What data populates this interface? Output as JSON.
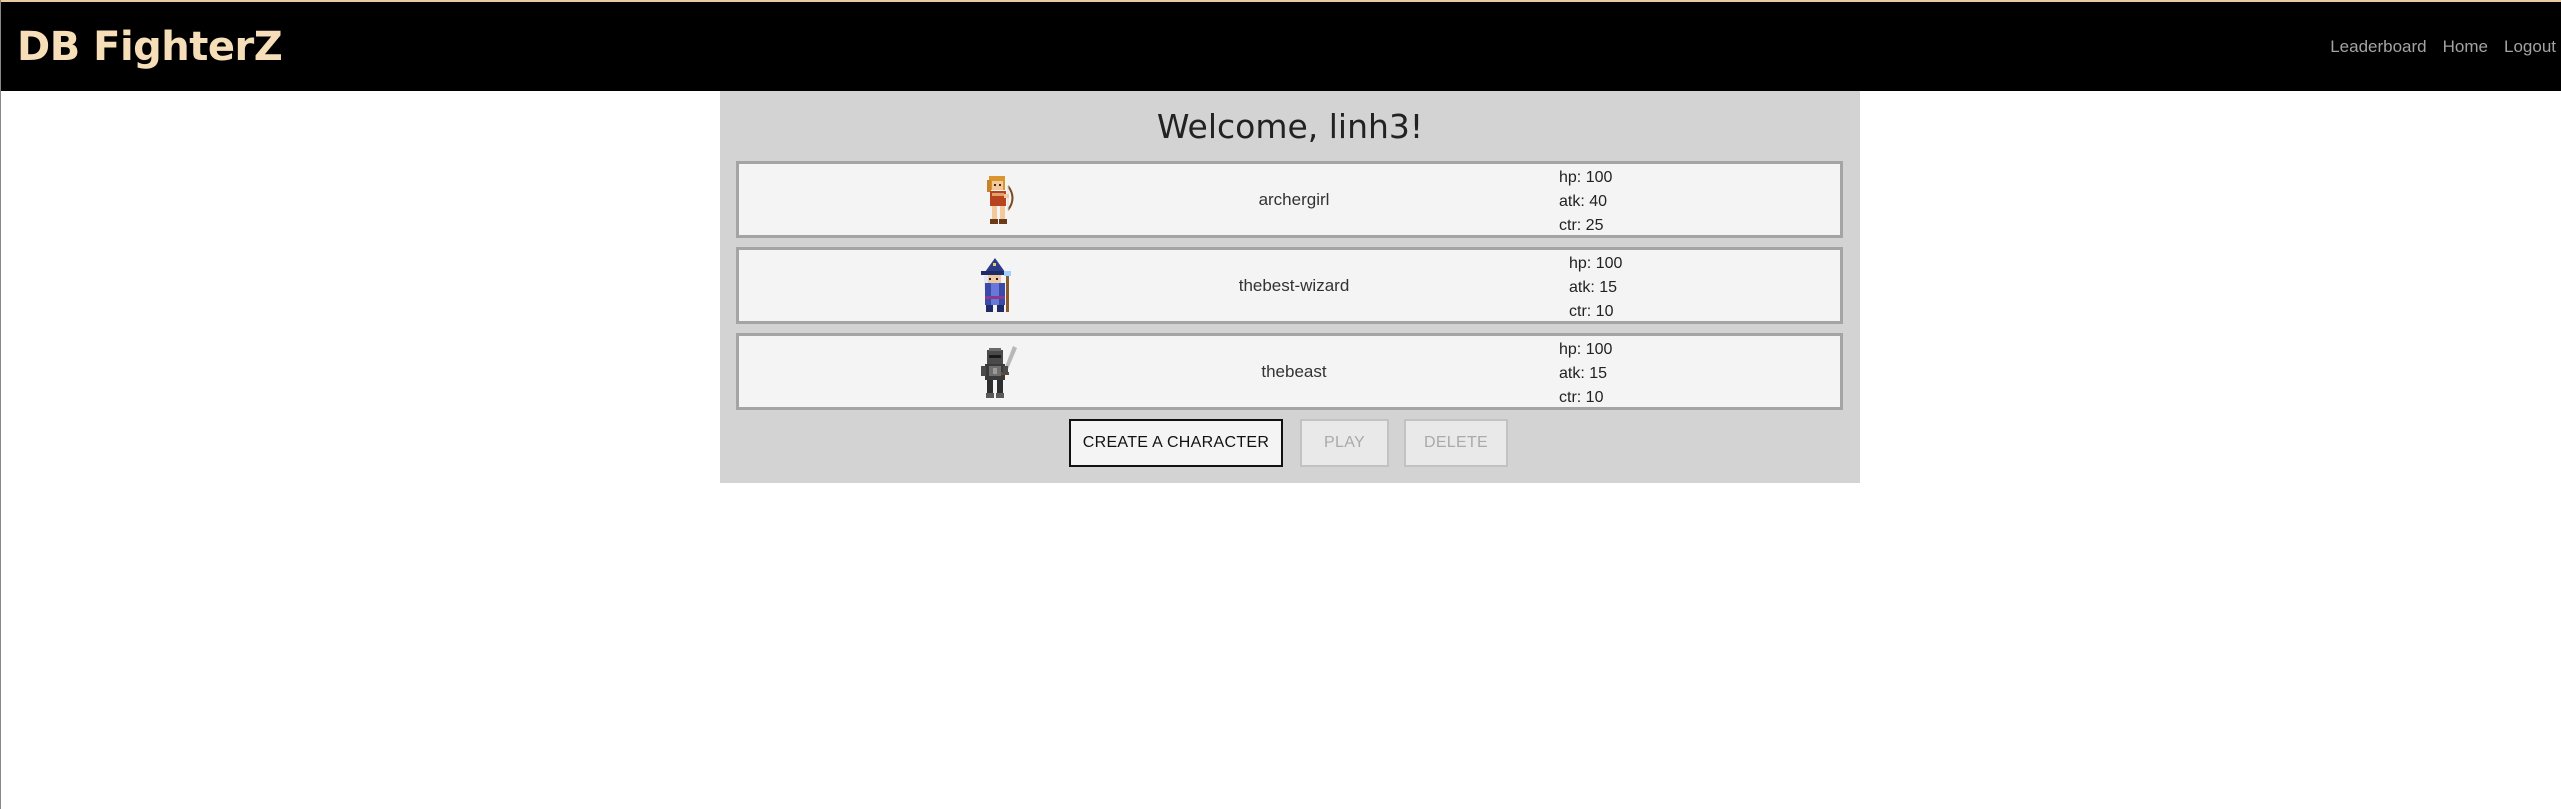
{
  "app": {
    "brand": "DB FighterZ",
    "nav": [
      "Leaderboard",
      "Home",
      "Logout"
    ]
  },
  "welcome": "Welcome, linh3!",
  "characters": [
    {
      "name": "archergirl",
      "sprite": "archer-girl-icon",
      "hp": "hp: 100",
      "atk": "atk: 40",
      "ctr": "ctr: 25"
    },
    {
      "name": "thebest-wizard",
      "sprite": "wizard-icon",
      "hp": "hp: 100",
      "atk": "atk: 15",
      "ctr": "ctr: 10"
    },
    {
      "name": "thebeast",
      "sprite": "knight-icon",
      "hp": "hp: 100",
      "atk": "atk: 15",
      "ctr": "ctr: 10"
    }
  ],
  "buttons": {
    "create": "CREATE A CHARACTER",
    "play": "PLAY",
    "delete": "DELETE"
  },
  "colors": {
    "navbar": "#000000",
    "brand": "#f5deb8",
    "panel": "#d3d3d3",
    "card": "#f4f4f4"
  }
}
